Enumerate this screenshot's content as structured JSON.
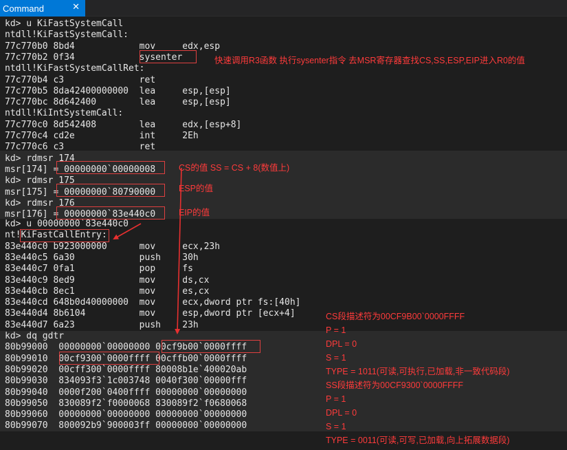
{
  "window": {
    "tab_title": "Command",
    "close_glyph": "✕"
  },
  "console": {
    "lines": [
      "kd> u KiFastSystemCall",
      "ntdll!KiFastSystemCall:",
      "77c770b0 8bd4            mov     edx,esp",
      "77c770b2 0f34            sysenter",
      "ntdll!KiFastSystemCallRet:",
      "77c770b4 c3              ret",
      "77c770b5 8da42400000000  lea     esp,[esp]",
      "77c770bc 8d642400        lea     esp,[esp]",
      "ntdll!KiIntSystemCall:",
      "77c770c0 8d542408        lea     edx,[esp+8]",
      "77c770c4 cd2e            int     2Eh",
      "77c770c6 c3              ret",
      "kd> rdmsr 174",
      "msr[174] = 00000000`00000008",
      "kd> rdmsr 175",
      "msr[175] = 00000000`80790000",
      "kd> rdmsr 176",
      "msr[176] = 00000000`83e440c0",
      "kd> u 00000000`83e440c0",
      "nt!KiFastCallEntry:",
      "83e440c0 b923000000      mov     ecx,23h",
      "83e440c5 6a30            push    30h",
      "83e440c7 0fa1            pop     fs",
      "83e440c9 8ed9            mov     ds,cx",
      "83e440cb 8ec1            mov     es,cx",
      "83e440cd 648b0d40000000  mov     ecx,dword ptr fs:[40h]",
      "83e440d4 8b6104          mov     esp,dword ptr [ecx+4]",
      "83e440d7 6a23            push    23h",
      "kd> dq gdtr",
      "80b99000  00000000`00000000 00cf9b00`0000ffff",
      "80b99010  00cf9300`0000ffff 00cffb00`0000ffff",
      "80b99020  00cff300`0000ffff 80008b1e`400020ab",
      "80b99030  834093f3`1c003748 0040f300`00000fff",
      "80b99040  0000f200`0400ffff 00000000`00000000",
      "80b99050  830089f2`f0000068 830089f2`f0680068",
      "80b99060  00000000`00000000 00000000`00000000",
      "80b99070  800092b9`900003ff 00000000`00000000"
    ]
  },
  "annotations": {
    "sysenter_note": "快速调用R3函数 执行sysenter指令 去MSR寄存器查找CS,SS,ESP,EIP进入R0的值",
    "cs_note": "CS的值 SS = CS + 8(数值上)",
    "esp_note": "ESP的值",
    "eip_note": "EIP的值",
    "descriptor_notes": [
      "CS段描述符为00CF9B00`0000FFFF",
      "P = 1",
      "DPL = 0",
      "S = 1",
      "TYPE = 1011(可读,可执行,已加载,非一致代码段)",
      "SS段描述符为00CF9300`0000FFFF",
      "P = 1",
      "DPL = 0",
      "S = 1",
      "TYPE = 0011(可读,可写,已加载,向上拓展数据段)"
    ]
  },
  "colors": {
    "annotation_red": "#ff3b3b",
    "box_red": "#e04040",
    "tab_blue": "#0078d7",
    "console_bg": "#1e1e1e",
    "band_bg": "#2b2b2b"
  }
}
